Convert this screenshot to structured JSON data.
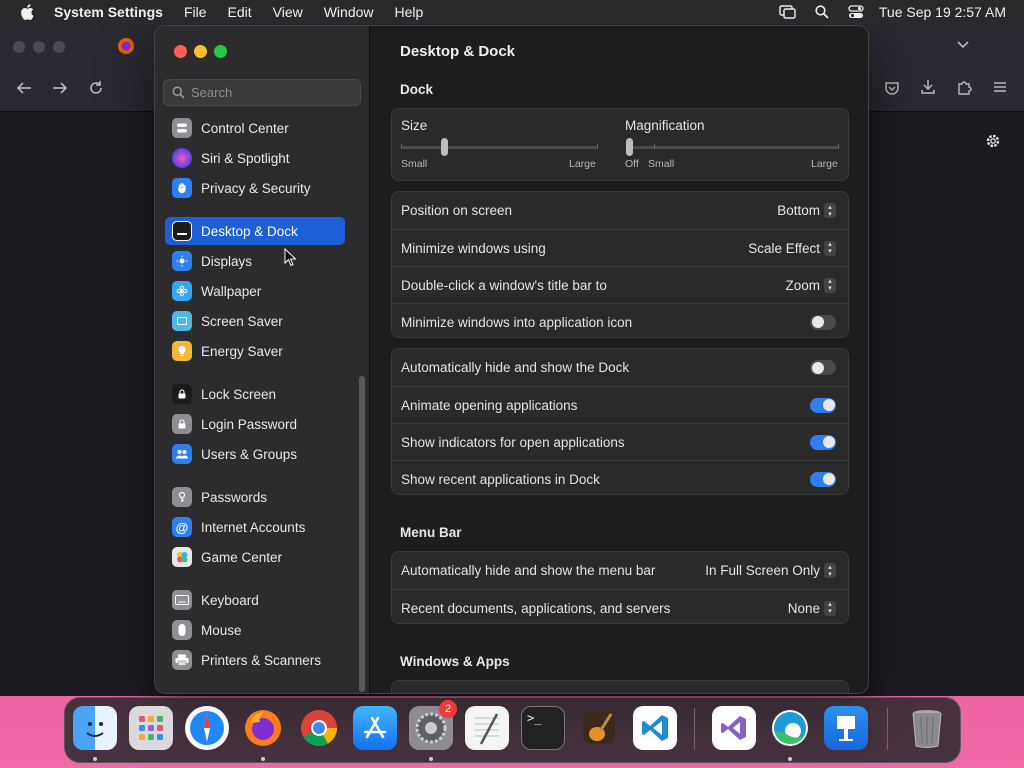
{
  "menubar": {
    "app_name": "System Settings",
    "items": [
      "File",
      "Edit",
      "View",
      "Window",
      "Help"
    ],
    "clock": "Tue Sep 19  2:57 AM",
    "icons": [
      "apple-icon",
      "screen-mirroring-icon",
      "spotlight-search-icon",
      "control-center-icon"
    ]
  },
  "sidebar": {
    "search_placeholder": "Search",
    "items": [
      {
        "label": "Control Center",
        "icon": "control-center-icon",
        "color": "#8e8e93"
      },
      {
        "label": "Siri & Spotlight",
        "icon": "siri-icon",
        "color": "#b14be8"
      },
      {
        "label": "Privacy & Security",
        "icon": "hand-icon",
        "color": "#2f7ff1"
      },
      {
        "label": "Desktop & Dock",
        "icon": "dock-icon",
        "color": "#1c1c1e",
        "active": true
      },
      {
        "label": "Displays",
        "icon": "sun-icon",
        "color": "#2f7ff1"
      },
      {
        "label": "Wallpaper",
        "icon": "flower-icon",
        "color": "#35a7f0"
      },
      {
        "label": "Screen Saver",
        "icon": "screen-saver-icon",
        "color": "#4fb6e8"
      },
      {
        "label": "Energy Saver",
        "icon": "bulb-icon",
        "color": "#f4b73a"
      },
      {
        "label": "Lock Screen",
        "icon": "lock-icon",
        "color": "#1c1c1e"
      },
      {
        "label": "Login Password",
        "icon": "lock-icon",
        "color": "#8e8e93"
      },
      {
        "label": "Users & Groups",
        "icon": "users-icon",
        "color": "#2f7ff1"
      },
      {
        "label": "Passwords",
        "icon": "key-icon",
        "color": "#8e8e93"
      },
      {
        "label": "Internet Accounts",
        "icon": "at-icon",
        "color": "#2f7ff1"
      },
      {
        "label": "Game Center",
        "icon": "game-center-icon",
        "color": "#e8e8e8"
      },
      {
        "label": "Keyboard",
        "icon": "keyboard-icon",
        "color": "#8e8e93"
      },
      {
        "label": "Mouse",
        "icon": "mouse-icon",
        "color": "#8e8e93"
      },
      {
        "label": "Printers & Scanners",
        "icon": "printer-icon",
        "color": "#8e8e93"
      }
    ]
  },
  "main": {
    "title": "Desktop & Dock",
    "dock_heading": "Dock",
    "size_slider": {
      "label": "Size",
      "min_label": "Small",
      "max_label": "Large",
      "value": 0.22
    },
    "magnification_slider": {
      "label": "Magnification",
      "off_label": "Off",
      "min_label": "Small",
      "max_label": "Large",
      "value": 0.0
    },
    "dock_settings": [
      {
        "label": "Position on screen",
        "value": "Bottom"
      },
      {
        "label": "Minimize windows using",
        "value": "Scale Effect"
      },
      {
        "label": "Double-click a window's title bar to",
        "value": "Zoom"
      },
      {
        "label": "Minimize windows into application icon",
        "toggle": false
      }
    ],
    "dock_toggles": [
      {
        "label": "Automatically hide and show the Dock",
        "toggle": false
      },
      {
        "label": "Animate opening applications",
        "toggle": true
      },
      {
        "label": "Show indicators for open applications",
        "toggle": true
      },
      {
        "label": "Show recent applications in Dock",
        "toggle": true
      }
    ],
    "menubar_heading": "Menu Bar",
    "menubar_settings": [
      {
        "label": "Automatically hide and show the menu bar",
        "value": "In Full Screen Only"
      },
      {
        "label": "Recent documents, applications, and servers",
        "value": "None"
      }
    ],
    "windows_heading": "Windows & Apps"
  },
  "dock": {
    "apps": [
      "Finder",
      "Launchpad",
      "Safari",
      "Firefox",
      "Chrome",
      "App Store",
      "System Settings",
      "TextEdit",
      "Terminal",
      "GarageBand",
      "Visual Studio Code",
      "Visual Studio",
      "Microsoft Edge",
      "Keynote",
      "Trash"
    ],
    "settings_badge": "2"
  },
  "colors": {
    "accent": "#1e5ed6",
    "toggle_on": "#2f7ff1",
    "wallpaper": "#e8408f"
  }
}
